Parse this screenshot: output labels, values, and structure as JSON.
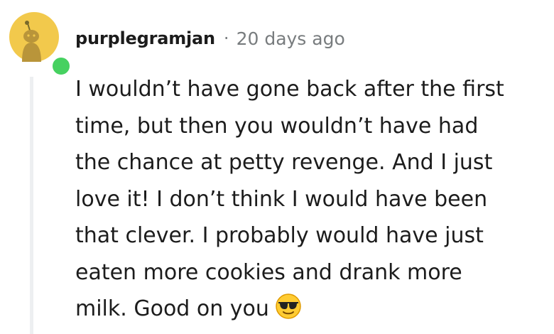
{
  "comment": {
    "author": {
      "username": "purplegramjan",
      "avatar_icon": "snoo-avatar-icon",
      "online_status_color": "#46d160"
    },
    "separator": "·",
    "timestamp": "20 days ago",
    "body_lines": [
      "I wouldn’t have gone back after the first",
      "time, but then you wouldn’t have had",
      "the chance at petty revenge. And I just",
      "love it! I don’t think I would have been",
      "that clever. I probably would have just",
      "eaten more cookies and drank more",
      "milk. Good on you"
    ],
    "emoji_icon": "sunglasses-emoji-icon"
  },
  "colors": {
    "avatar_background": "#f2c94c",
    "thread_line": "#edeff1",
    "text": "#1c1c1c",
    "meta_text": "#787c7e"
  }
}
